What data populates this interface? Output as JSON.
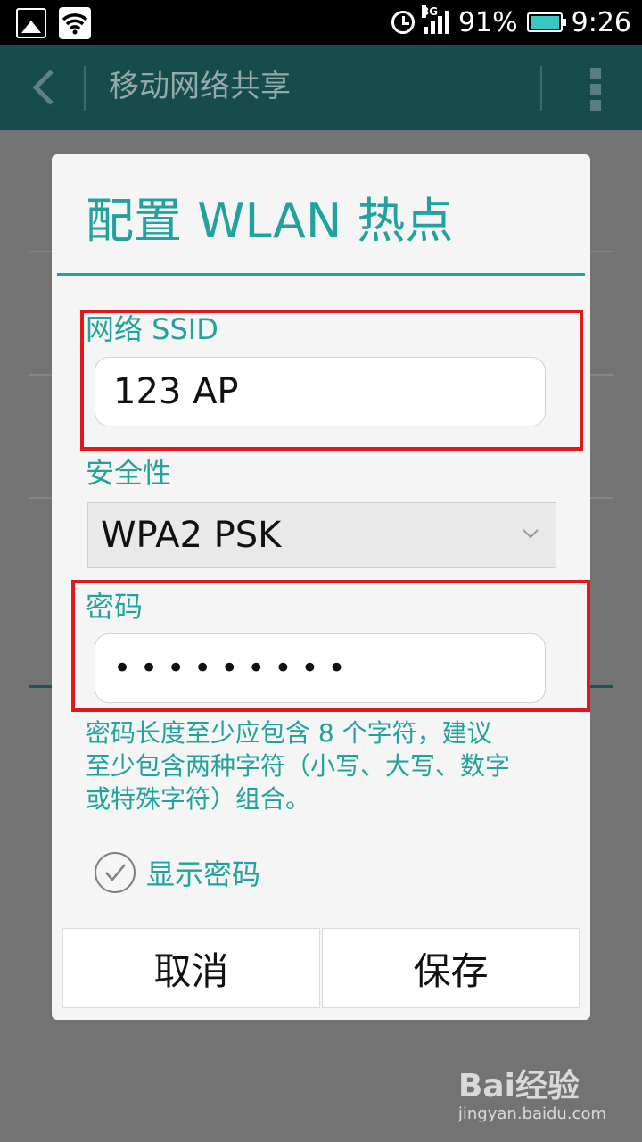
{
  "status_bar": {
    "battery_percent": "91%",
    "time": "9:26",
    "network_type": "3G",
    "battery_color": "#3cc7c7"
  },
  "toolbar": {
    "title": "移动网络共享",
    "back_icon": "chevron-left-icon",
    "overflow_icon": "overflow-menu-icon"
  },
  "dialog": {
    "title": "配置 WLAN 热点",
    "ssid_label": "网络 SSID",
    "ssid_value": "123 AP",
    "security_label": "安全性",
    "security_value": "WPA2 PSK",
    "password_label": "密码",
    "password_value": "•••••••••",
    "hint_line1": "密码长度至少应包含 8 个字符，建议",
    "hint_line2": "至少包含两种字符（小写、大写、数字",
    "hint_line3": "或特殊字符）组合。",
    "show_password_label": "显示密码",
    "show_password_checked": true,
    "cancel_label": "取消",
    "save_label": "保存",
    "accent_color": "#22a29c"
  },
  "watermark": {
    "logo_text": "Bai经验",
    "url": "jingyan.baidu.com"
  },
  "highlight_color": "#e01a1a"
}
